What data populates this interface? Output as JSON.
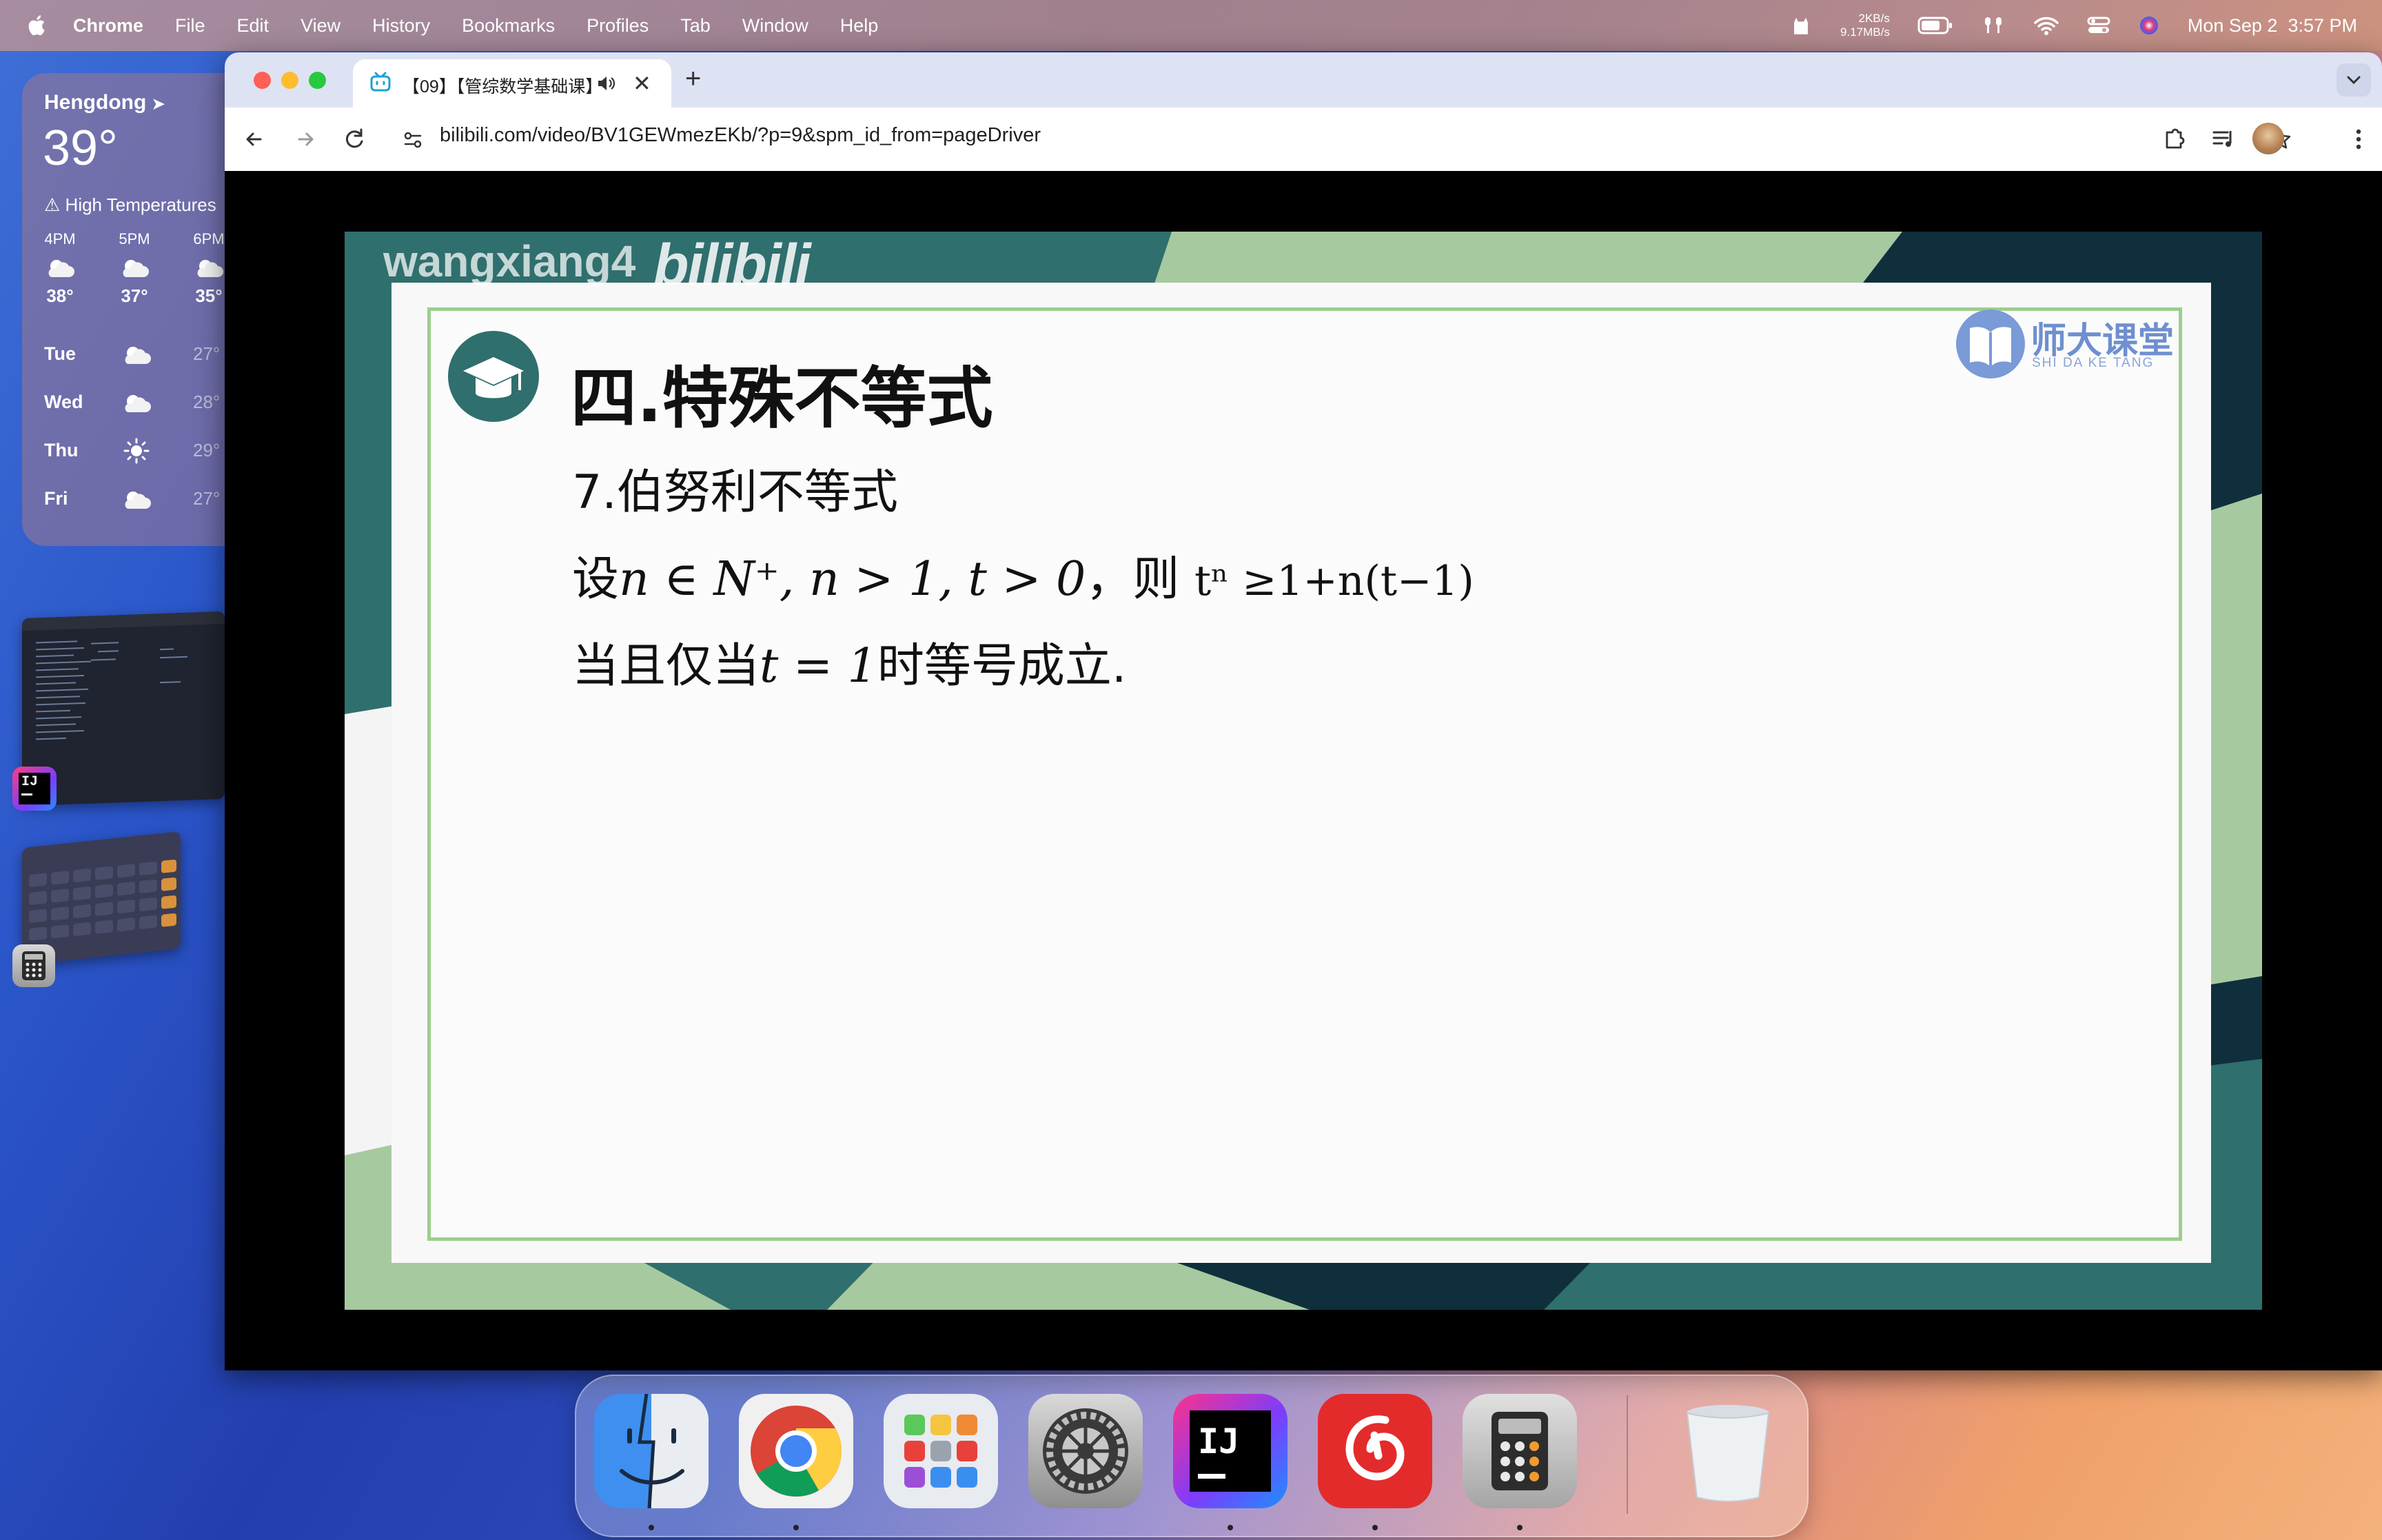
{
  "menubar": {
    "app_name": "Chrome",
    "items": [
      "File",
      "Edit",
      "View",
      "History",
      "Bookmarks",
      "Profiles",
      "Tab",
      "Window",
      "Help"
    ],
    "net_up": "2KB/s",
    "net_down": "9.17MB/s",
    "datetime": "Mon Sep 2  3:57 PM"
  },
  "weather": {
    "city": "Hengdong",
    "temperature": "39°",
    "alert": "High Temperatures",
    "hourly": [
      {
        "time": "4PM",
        "temp": "38°",
        "icon": "partly-sunny-icon"
      },
      {
        "time": "5PM",
        "temp": "37°",
        "icon": "partly-sunny-icon"
      },
      {
        "time": "6PM",
        "temp": "35°",
        "icon": "partly-sunny-icon"
      }
    ],
    "daily": [
      {
        "day": "Tue",
        "temp": "27°",
        "icon": "partly-sunny-icon"
      },
      {
        "day": "Wed",
        "temp": "28°",
        "icon": "partly-sunny-icon"
      },
      {
        "day": "Thu",
        "temp": "29°",
        "icon": "sun-icon"
      },
      {
        "day": "Fri",
        "temp": "27°",
        "icon": "partly-sunny-icon"
      }
    ]
  },
  "browser": {
    "tab_title": "【09】【管综数学基础课】",
    "url_host": "bilibili.com",
    "url_path": "/video/BV1GEWmezEKb/?p=9&spm_id_from=pageDriver"
  },
  "video": {
    "uploader_watermark": "wangxiang4",
    "site_watermark": "bilibili",
    "brand_name": "师大课堂",
    "brand_sub": "SHI DA KE TANG",
    "slide": {
      "title": "四.特殊不等式",
      "subtitle": "7.伯努利不等式",
      "line1_prefix": "设",
      "line1_math": "n ∈ N⁺, n > 1, t > 0",
      "line1_then": "，则",
      "line1_formula": "tⁿ ≥1+n(t−1)",
      "line2_prefix": "当且仅当",
      "line2_math": "t = 1",
      "line2_suffix": "时等号成立."
    }
  },
  "dock": {
    "apps": [
      "Finder",
      "Google Chrome",
      "Launchpad",
      "System Settings",
      "IntelliJ IDEA",
      "NetEase Cloud Music",
      "Calculator",
      "Trash"
    ]
  },
  "colors": {
    "slide_teal": "#2f6f6d",
    "slide_green": "#9bcf8d",
    "brand_blue": "#6e8fd0"
  }
}
